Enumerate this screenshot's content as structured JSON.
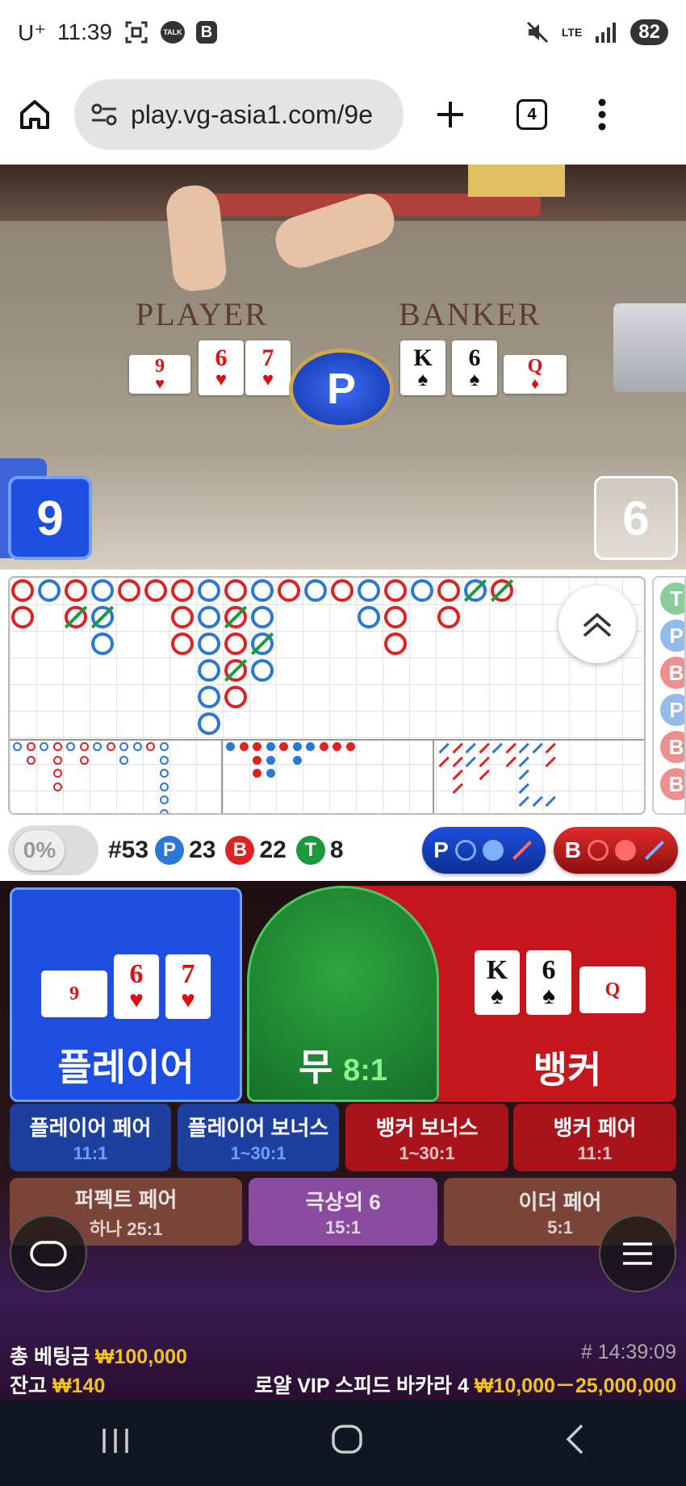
{
  "status_bar": {
    "carrier": "U⁺",
    "time": "11:39",
    "icons": [
      "screenshot-icon",
      "kakaotalk-icon",
      "band-icon"
    ],
    "kakao_label": "TALK",
    "band_label": "B",
    "network": "LTE",
    "battery": "82"
  },
  "browser": {
    "url": "play.vg-asia1.com/9e",
    "tab_count": "4"
  },
  "video": {
    "player_label": "PLAYER",
    "banker_label": "BANKER",
    "result_chip": "P",
    "player_score": "9",
    "banker_score": "6",
    "player_cards": [
      {
        "rank": "9",
        "suit": "♥",
        "color": "red",
        "rotated": true
      },
      {
        "rank": "6",
        "suit": "♥",
        "color": "red"
      },
      {
        "rank": "7",
        "suit": "♥",
        "color": "red"
      }
    ],
    "banker_cards": [
      {
        "rank": "K",
        "suit": "♠",
        "color": "black"
      },
      {
        "rank": "6",
        "suit": "♠",
        "color": "black"
      },
      {
        "rank": "Q",
        "suit": "♦",
        "color": "red",
        "rotated": true
      }
    ]
  },
  "roadmap": {
    "side_badges": [
      {
        "label": "T",
        "color": "#1a9a3a"
      },
      {
        "label": "P",
        "color": "#2a78d6"
      },
      {
        "label": "B",
        "color": "#d22"
      },
      {
        "label": "P",
        "color": "#2a78d6"
      },
      {
        "label": "B",
        "color": "#d22"
      },
      {
        "label": "B",
        "color": "#d22"
      }
    ]
  },
  "stats": {
    "percent": "0%",
    "round": "#53",
    "player_label": "P",
    "player_count": "23",
    "banker_label": "B",
    "banker_count": "22",
    "tie_label": "T",
    "tie_count": "8",
    "player_ask": "P",
    "banker_ask": "B"
  },
  "bets": {
    "player": "플레이어",
    "tie": "무",
    "tie_odds": "8:1",
    "banker": "뱅커",
    "player_pair": {
      "title": "플레이어 페어",
      "odds": "11:1"
    },
    "player_bonus": {
      "title": "플레이어 보너스",
      "odds": "1~30:1"
    },
    "banker_bonus": {
      "title": "뱅커 보너스",
      "odds": "1~30:1"
    },
    "banker_pair": {
      "title": "뱅커 페어",
      "odds": "11:1"
    },
    "perfect_pair": {
      "title": "퍼펙트 페어",
      "odds": "하나 25:1"
    },
    "super6": {
      "title": "극상의 6",
      "odds": "15:1"
    },
    "either_pair": {
      "title": "이더 페어",
      "odds": "5:1"
    }
  },
  "footer": {
    "total_bet_label": "총 베팅금",
    "total_bet_value": "₩100,000",
    "balance_label": "잔고",
    "balance_value": "₩140",
    "game_id": "# 14:39:09",
    "table_name": "로얄 VIP 스피드 바카라 4",
    "limits": "₩10,000－25,000,000"
  },
  "colors": {
    "player_blue": "#1f4fe0",
    "banker_red": "#c4161c",
    "tie_green": "#1e8a2c",
    "gold": "#f0c419"
  }
}
